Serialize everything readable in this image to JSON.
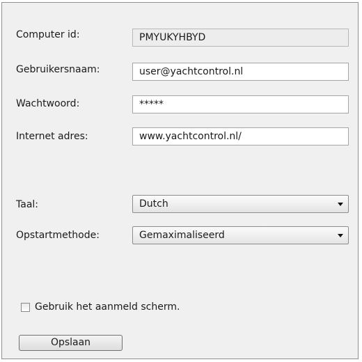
{
  "form": {
    "computer_id": {
      "label": "Computer id:",
      "value": "PMYUKYHBYD"
    },
    "username": {
      "label": "Gebruikersnaam:",
      "value": "user@yachtcontrol.nl"
    },
    "password": {
      "label": "Wachtwoord:",
      "value": "*****"
    },
    "internet_address": {
      "label": "Internet adres:",
      "value": "www.yachtcontrol.nl/"
    },
    "language": {
      "label": "Taal:",
      "selected": "Dutch"
    },
    "startup_method": {
      "label": "Opstartmethode:",
      "selected": "Gemaximaliseerd"
    },
    "login_screen_checkbox": {
      "label": "Gebruik het aanmeld scherm.",
      "checked": false
    },
    "save_button": {
      "label": "Opslaan"
    }
  },
  "icons": {
    "dropdown": "chevron-down-icon"
  }
}
